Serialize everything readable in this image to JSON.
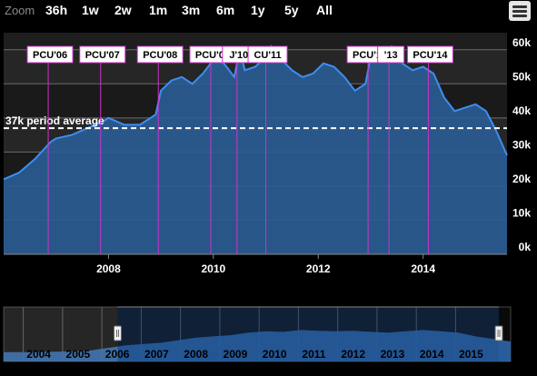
{
  "zoom": {
    "label": "Zoom",
    "buttons": [
      "36h",
      "1w",
      "2w",
      "1m",
      "3m",
      "6m",
      "1y",
      "5y",
      "All"
    ]
  },
  "menu": {
    "icon": "hamburger-menu-icon"
  },
  "colors": {
    "background": "#000000",
    "series_fill": "#2b5d96",
    "series_line": "#3d8ef0",
    "flag_line": "#cc33cc",
    "average_line": "#ffffff",
    "navigator_fill": "#2b66aa"
  },
  "chart_data": {
    "type": "area",
    "title": "",
    "xlabel": "",
    "ylabel": "",
    "ylim": [
      0,
      65000
    ],
    "xlim": [
      2006.0,
      2015.6
    ],
    "x_ticks": [
      "2008",
      "2010",
      "2012",
      "2014"
    ],
    "y_ticks": [
      "0k",
      "10k",
      "20k",
      "30k",
      "40k",
      "50k",
      "60k"
    ],
    "grid": true,
    "average": {
      "label": "37k period average",
      "value": 37000
    },
    "series": [
      {
        "x": [
          2006.0,
          2006.3,
          2006.6,
          2006.9,
          2007.0,
          2007.3,
          2007.6,
          2007.9,
          2008.0,
          2008.3,
          2008.6,
          2008.9,
          2009.0,
          2009.2,
          2009.4,
          2009.6,
          2009.8,
          2010.0,
          2010.2,
          2010.4,
          2010.5,
          2010.6,
          2010.8,
          2011.0,
          2011.1,
          2011.3,
          2011.5,
          2011.7,
          2011.9,
          2012.1,
          2012.3,
          2012.5,
          2012.7,
          2012.9,
          2013.0,
          2013.2,
          2013.4,
          2013.6,
          2013.8,
          2014.0,
          2014.2,
          2014.4,
          2014.6,
          2014.8,
          2015.0,
          2015.2,
          2015.4,
          2015.6
        ],
        "y": [
          22000,
          24000,
          28000,
          33000,
          34000,
          35000,
          37000,
          39000,
          40000,
          38000,
          38000,
          41000,
          48000,
          51000,
          52000,
          50000,
          53000,
          57000,
          56000,
          52000,
          60000,
          54000,
          55000,
          58000,
          61000,
          57000,
          54000,
          52000,
          53000,
          56000,
          55000,
          52000,
          48000,
          50000,
          58000,
          59000,
          61000,
          56000,
          54000,
          55000,
          53000,
          46000,
          42000,
          43000,
          44000,
          42000,
          36000,
          29000
        ]
      }
    ],
    "flags": [
      {
        "label": "PCU'06",
        "x": 2006.85
      },
      {
        "label": "PCU'07",
        "x": 2007.85
      },
      {
        "label": "PCU'08",
        "x": 2008.95
      },
      {
        "label": "PCU'09",
        "x": 2009.95
      },
      {
        "label": "J'10",
        "x": 2010.45
      },
      {
        "label": "CU'11",
        "x": 2011.0
      },
      {
        "label": "PCU'12",
        "x": 2012.95
      },
      {
        "label": "'13",
        "x": 2013.35
      },
      {
        "label": "PCU'14",
        "x": 2014.1
      }
    ]
  },
  "navigator": {
    "labels": [
      "2004",
      "2005",
      "2006",
      "2007",
      "2008",
      "2009",
      "2010",
      "2011",
      "2012",
      "2013",
      "2014",
      "2015"
    ],
    "range": [
      2003.0,
      2015.9
    ],
    "selected_from": 2005.9,
    "selected_to": 2015.6,
    "values": [
      0.08,
      0.08,
      0.09,
      0.1,
      0.12,
      0.15,
      0.25,
      0.35,
      0.4,
      0.45,
      0.55,
      0.65,
      0.7,
      0.75,
      0.85,
      0.9,
      0.88,
      0.95,
      0.92,
      0.9,
      0.92,
      0.88,
      0.85,
      0.9,
      0.95,
      0.9,
      0.85,
      0.7,
      0.6,
      0.5
    ]
  }
}
